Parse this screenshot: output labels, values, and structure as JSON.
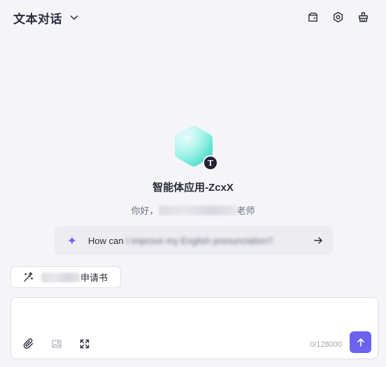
{
  "header": {
    "title": "文本对话",
    "tools": [
      "wallet-icon",
      "settings-icon",
      "clean-icon"
    ]
  },
  "agent": {
    "name": "智能体应用-ZcxX",
    "badge_letter": "T",
    "greeting_prefix": "你好，",
    "greeting_suffix": "老师"
  },
  "suggestion": {
    "visible_text": "How can",
    "blurred_text": "I improve my English pronunciation?"
  },
  "chip": {
    "label_suffix": "申请书"
  },
  "input": {
    "placeholder": "",
    "counter": "0/128000"
  },
  "colors": {
    "accent": "#6b62f2",
    "background": "#f5f5f8"
  }
}
